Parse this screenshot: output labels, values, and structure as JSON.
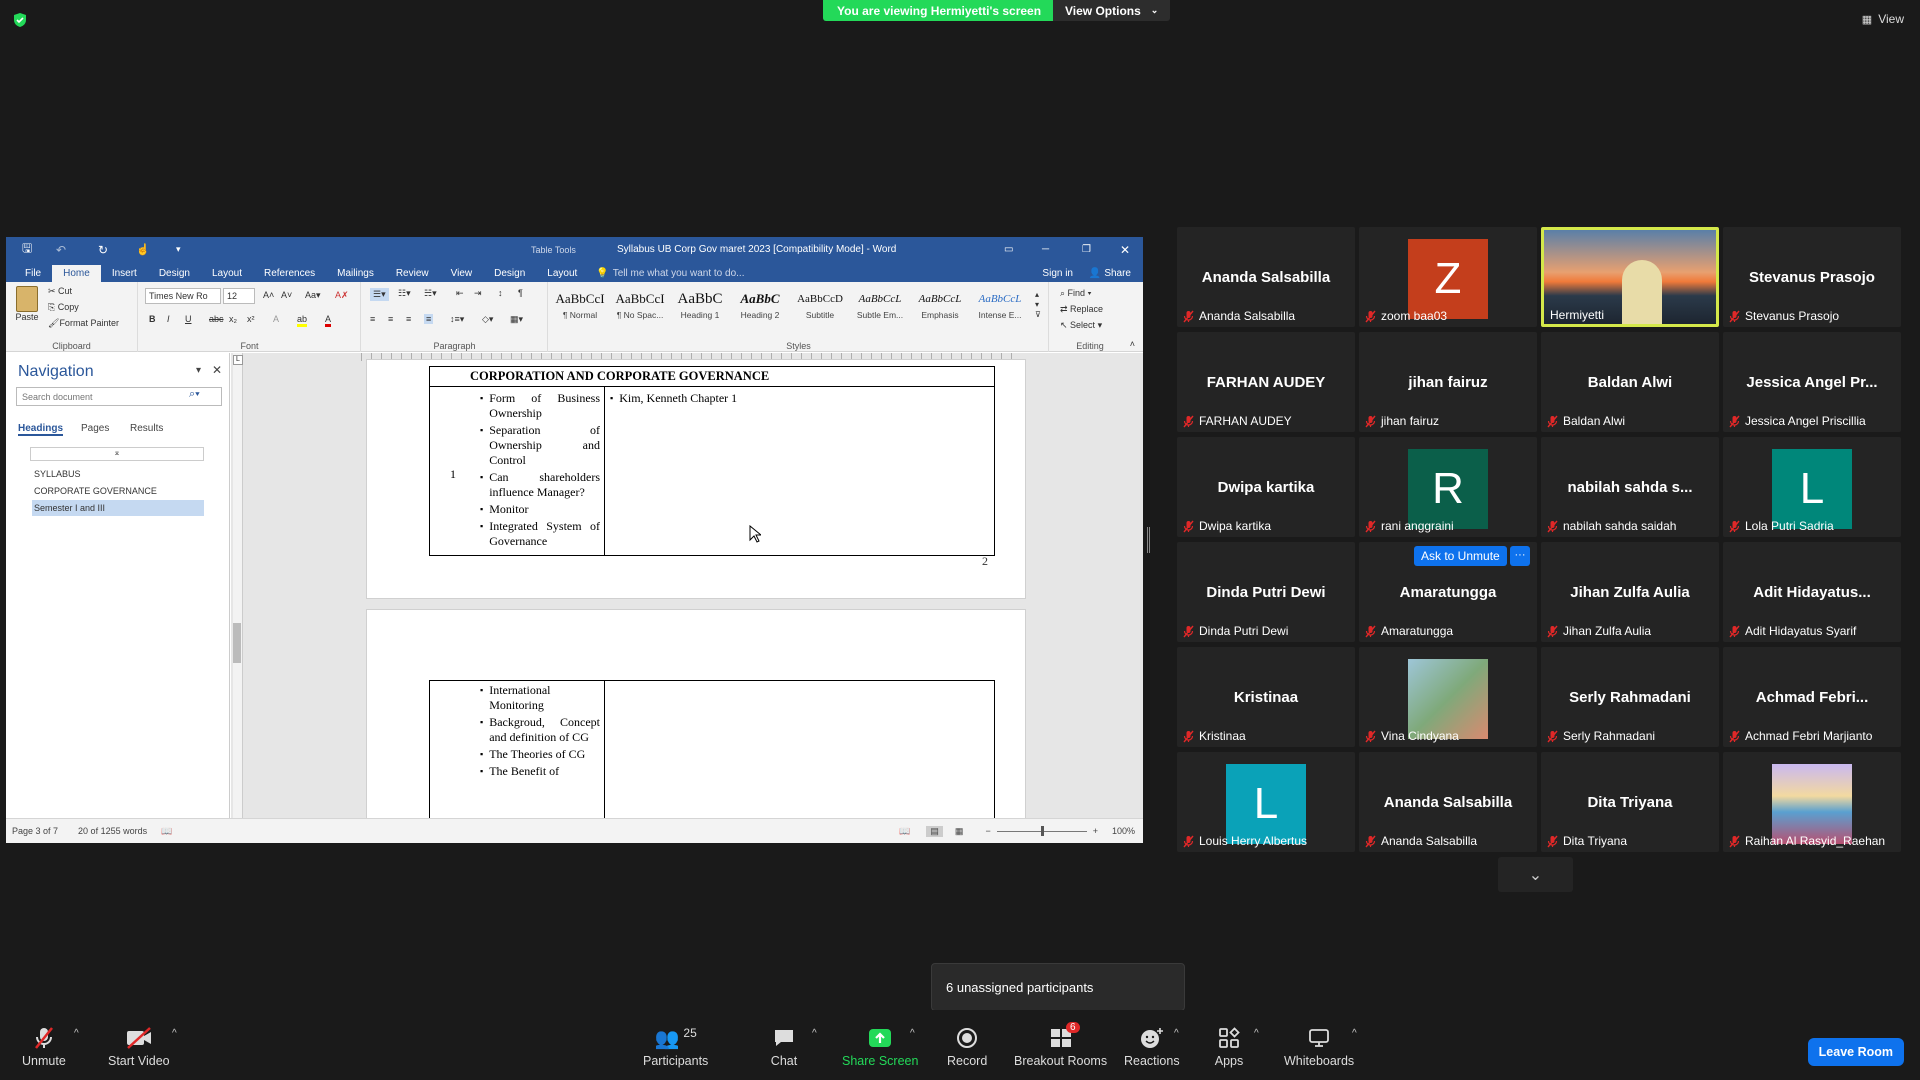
{
  "zoom": {
    "viewing_banner": "You are viewing Hermiyetti's screen",
    "view_options": "View Options",
    "view_button": "View",
    "ask_to_unmute": "Ask to Unmute",
    "more_button": "···",
    "unassigned": "6 unassigned participants",
    "accent_green": "#23d959",
    "accent_blue": "#0e72ed"
  },
  "word": {
    "title": "Syllabus UB Corp Gov maret 2023 [Compatibility Mode] - Word",
    "table_tools": "Table Tools",
    "tabs": [
      "File",
      "Home",
      "Insert",
      "Design",
      "Layout",
      "References",
      "Mailings",
      "Review",
      "View",
      "Design",
      "Layout"
    ],
    "tell_me": "Tell me what you want to do...",
    "sign_in": "Sign in",
    "share": "Share",
    "clipboard": {
      "paste": "Paste",
      "cut": "Cut",
      "copy": "Copy",
      "format_painter": "Format Painter",
      "label": "Clipboard"
    },
    "font": {
      "name": "Times New Ro",
      "size": "12",
      "label": "Font"
    },
    "paragraph_label": "Paragraph",
    "styles": [
      {
        "sample": "AaBbCcI",
        "name": "¶ Normal"
      },
      {
        "sample": "AaBbCcI",
        "name": "¶ No Spac..."
      },
      {
        "sample": "AaBbC",
        "name": "Heading 1"
      },
      {
        "sample": "AaBbC",
        "name": "Heading 2"
      },
      {
        "sample": "AaBbCcD",
        "name": "Subtitle"
      },
      {
        "sample": "AaBbCcL",
        "name": "Subtle Em..."
      },
      {
        "sample": "AaBbCcL",
        "name": "Emphasis"
      },
      {
        "sample": "AaBbCcL",
        "name": "Intense E..."
      }
    ],
    "styles_label": "Styles",
    "editing": {
      "find": "Find",
      "replace": "Replace",
      "select": "Select",
      "label": "Editing"
    },
    "navigation": {
      "title": "Navigation",
      "search_placeholder": "Search document",
      "tabs": [
        "Headings",
        "Pages",
        "Results"
      ],
      "headings": [
        "SYLLABUS",
        "CORPORATE GOVERNANCE",
        "Semester I and III"
      ]
    },
    "doc": {
      "table_title": "CORPORATION AND CORPORATE GOVERNANCE",
      "row_number": "1",
      "topics": [
        "Form of Business Ownership",
        "Separation of Ownership and Control",
        "Can shareholders influence Manager?",
        "Monitor",
        "Integrated System of Governance"
      ],
      "reference": "Kim, Kenneth Chapter 1",
      "page_number": "2",
      "topics2": [
        "International Monitoring",
        "Backgroud, Concept and definition of CG",
        "The Theories of CG",
        "The Benefit of"
      ]
    },
    "status": {
      "page": "Page 3 of 7",
      "words": "20 of 1255 words",
      "zoom": "100%"
    }
  },
  "participants": [
    {
      "display": "Ananda Salsabilla",
      "label": "Ananda Salsabilla"
    },
    {
      "display": "Z",
      "label": "zoom baa03",
      "avatar_color": "#c43e1c"
    },
    {
      "display": "",
      "label": "Hermiyetti",
      "video": true
    },
    {
      "display": "Stevanus Prasojo",
      "label": "Stevanus Prasojo"
    },
    {
      "display": "FARHAN AUDEY",
      "label": "FARHAN AUDEY"
    },
    {
      "display": "jihan fairuz",
      "label": "jihan fairuz"
    },
    {
      "display": "Baldan Alwi",
      "label": "Baldan Alwi"
    },
    {
      "display": "Jessica Angel Pr...",
      "label": "Jessica Angel Priscillia"
    },
    {
      "display": "Dwipa kartika",
      "label": "Dwipa kartika"
    },
    {
      "display": "R",
      "label": "rani anggraini",
      "avatar_color": "#0b5f4a"
    },
    {
      "display": "nabilah sahda s...",
      "label": "nabilah sahda saidah"
    },
    {
      "display": "L",
      "label": "Lola Putri Sadria",
      "avatar_color": "#00877a"
    },
    {
      "display": "Dinda Putri Dewi",
      "label": "Dinda Putri Dewi"
    },
    {
      "display": "Amaratungga",
      "label": "Amaratungga"
    },
    {
      "display": "Jihan Zulfa Aulia",
      "label": "Jihan Zulfa Aulia"
    },
    {
      "display": "Adit Hidayatus...",
      "label": "Adit Hidayatus Syarif"
    },
    {
      "display": "Kristinaa",
      "label": "Kristinaa"
    },
    {
      "display": "",
      "label": "Vina Cindyana",
      "image": "plant"
    },
    {
      "display": "Serly Rahmadani",
      "label": "Serly Rahmadani"
    },
    {
      "display": "Achmad Febri...",
      "label": "Achmad Febri Marjianto"
    },
    {
      "display": "L",
      "label": "Louis Herry Albertus",
      "avatar_color": "#0aa2b8"
    },
    {
      "display": "Ananda Salsabilla",
      "label": "Ananda Salsabilla"
    },
    {
      "display": "Dita Triyana",
      "label": "Dita Triyana"
    },
    {
      "display": "",
      "label": "Raihan Al Rasyid_Raehan",
      "image": "mountain"
    }
  ],
  "toolbar": {
    "unmute": "Unmute",
    "start_video": "Start Video",
    "participants": "Participants",
    "participants_count": "25",
    "chat": "Chat",
    "share_screen": "Share Screen",
    "record": "Record",
    "breakout": "Breakout Rooms",
    "breakout_badge": "6",
    "reactions": "Reactions",
    "apps": "Apps",
    "whiteboards": "Whiteboards",
    "leave": "Leave Room"
  }
}
